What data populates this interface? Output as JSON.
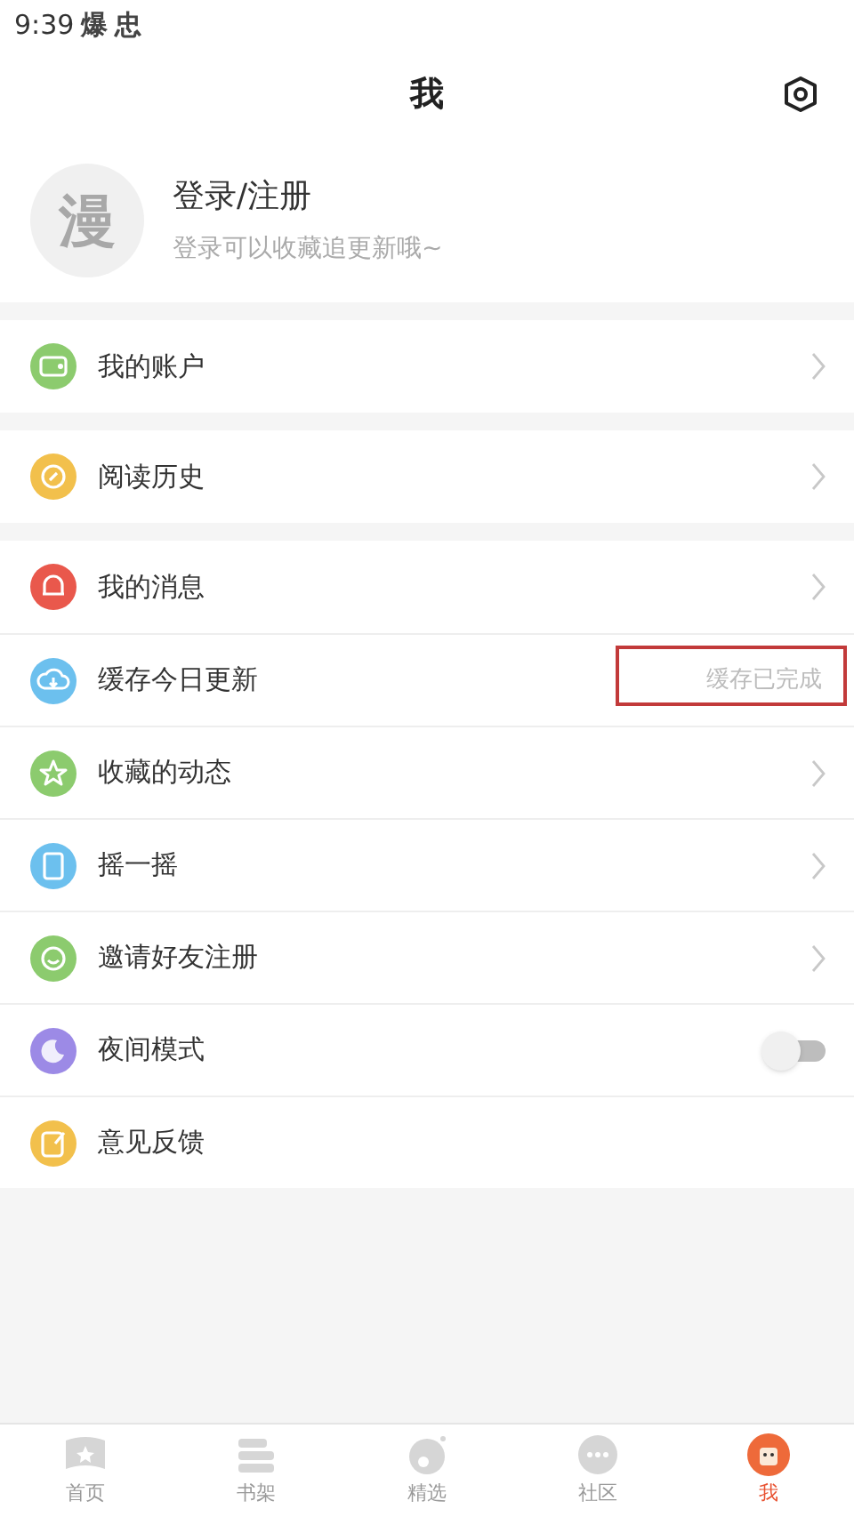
{
  "status_bar": {
    "time": "9:39",
    "app_names": [
      "爆",
      "忠"
    ]
  },
  "header": {
    "title": "我"
  },
  "profile": {
    "name": "登录/注册",
    "subtitle": "登录可以收藏追更新哦~",
    "avatar_text": "漫"
  },
  "groups": [
    [
      {
        "label": "我的账户",
        "kind": "chevron",
        "color": "#8ccb6e"
      }
    ],
    [
      {
        "label": "阅读历史",
        "kind": "chevron",
        "color": "#f2c04c"
      }
    ],
    [
      {
        "label": "我的消息",
        "kind": "chevron",
        "color": "#e9584c"
      },
      {
        "label": "缓存今日更新",
        "kind": "status",
        "color": "#6cc0ee",
        "status": "缓存已完成",
        "highlighted": true
      },
      {
        "label": "收藏的动态",
        "kind": "chevron",
        "color": "#8ccb6e"
      },
      {
        "label": "摇一摇",
        "kind": "chevron",
        "color": "#6cc0ee"
      },
      {
        "label": "邀请好友注册",
        "kind": "chevron",
        "color": "#8ccb6e"
      },
      {
        "label": "夜间模式",
        "kind": "toggle",
        "color": "#9c8ae6",
        "on": false
      },
      {
        "label": "意见反馈",
        "kind": "plain",
        "color": "#f2c04c"
      }
    ]
  ],
  "tabs": [
    {
      "label": "首页",
      "selected": false
    },
    {
      "label": "书架",
      "selected": false
    },
    {
      "label": "精选",
      "selected": false
    },
    {
      "label": "社区",
      "selected": false
    },
    {
      "label": "我",
      "selected": true
    }
  ]
}
